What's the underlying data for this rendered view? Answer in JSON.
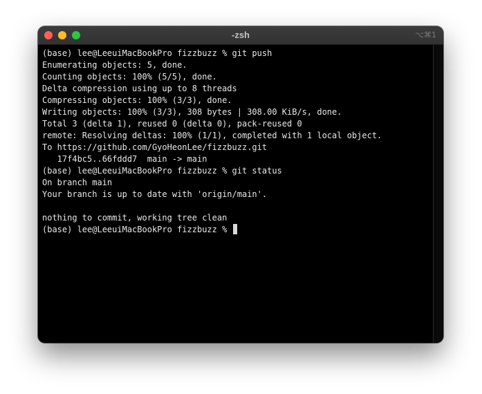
{
  "window": {
    "title": "-zsh",
    "shortcut": "⌥⌘1"
  },
  "terminal": {
    "lines": [
      "(base) lee@LeeuiMacBookPro fizzbuzz % git push",
      "Enumerating objects: 5, done.",
      "Counting objects: 100% (5/5), done.",
      "Delta compression using up to 8 threads",
      "Compressing objects: 100% (3/3), done.",
      "Writing objects: 100% (3/3), 308 bytes | 308.00 KiB/s, done.",
      "Total 3 (delta 1), reused 0 (delta 0), pack-reused 0",
      "remote: Resolving deltas: 100% (1/1), completed with 1 local object.",
      "To https://github.com/GyoHeonLee/fizzbuzz.git",
      "   17f4bc5..66fddd7  main -> main",
      "(base) lee@LeeuiMacBookPro fizzbuzz % git status",
      "On branch main",
      "Your branch is up to date with 'origin/main'.",
      "",
      "nothing to commit, working tree clean"
    ],
    "prompt": "(base) lee@LeeuiMacBookPro fizzbuzz % "
  }
}
